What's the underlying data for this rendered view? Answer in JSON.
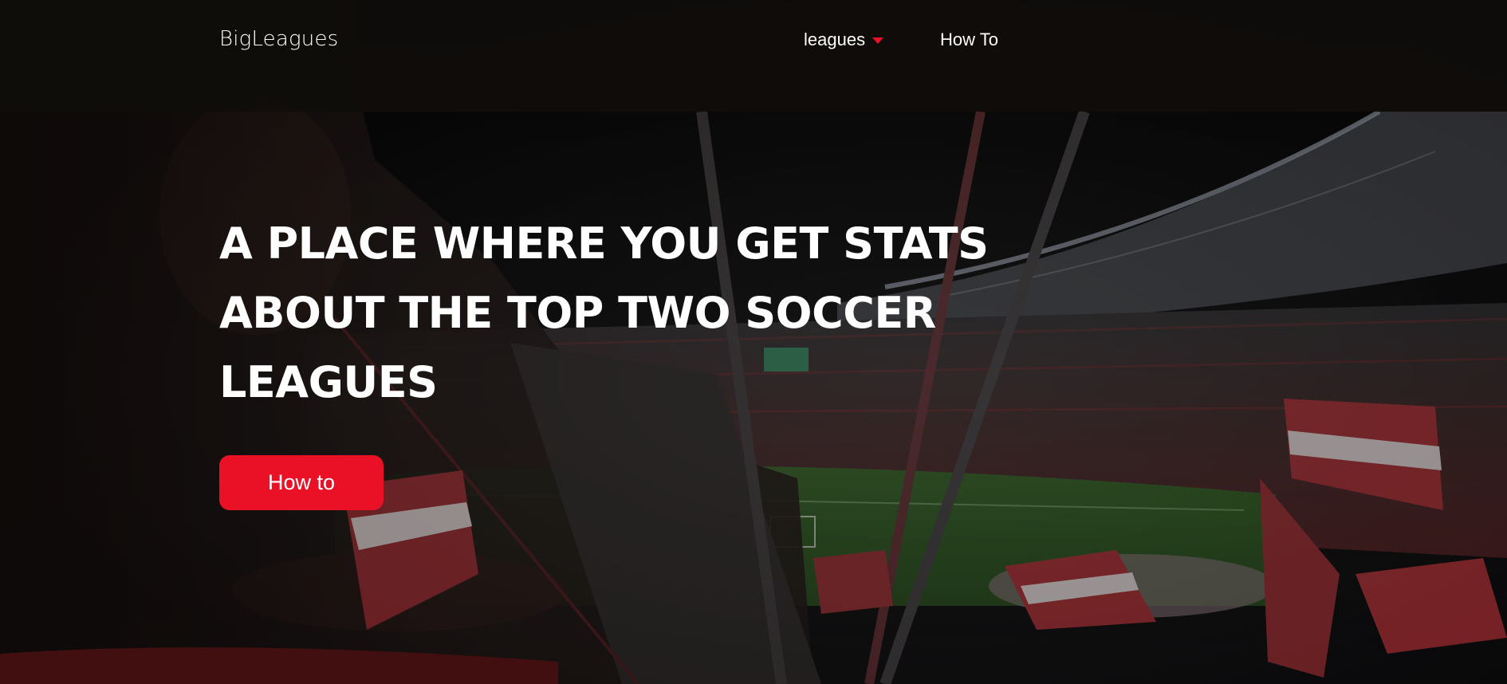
{
  "nav": {
    "logo": "BigLeagues",
    "items": [
      {
        "label": "leagues",
        "has_dropdown": true
      },
      {
        "label": "How To",
        "has_dropdown": false
      }
    ]
  },
  "hero": {
    "title": "A PLACE WHERE YOU GET STATS ABOUT THE TOP TWO SOCCER LEAGUES",
    "cta_label": "How to"
  },
  "colors": {
    "accent": "#ea1127",
    "text": "#ffffff",
    "background": "#0b0908"
  },
  "icons": {
    "dropdown": "caret-down-icon"
  }
}
